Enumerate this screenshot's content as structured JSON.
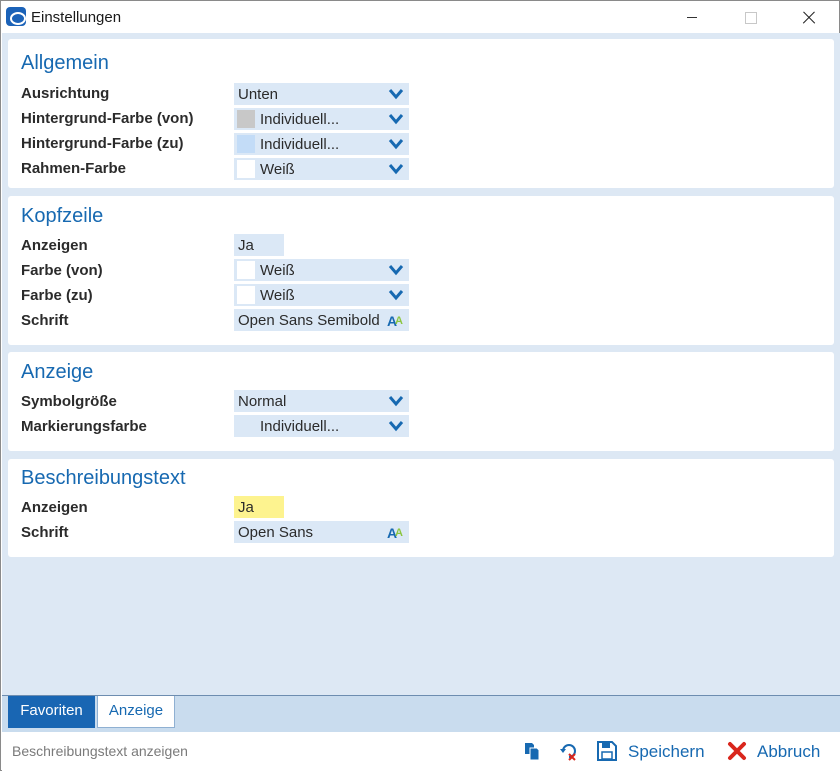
{
  "window": {
    "title": "Einstellungen"
  },
  "sections": {
    "allgemein": {
      "title": "Allgemein",
      "rows": [
        {
          "label": "Ausrichtung",
          "value": "Unten"
        },
        {
          "label": "Hintergrund-Farbe (von)",
          "value": "Individuell...",
          "swatch": "#c8c8c8"
        },
        {
          "label": "Hintergrund-Farbe (zu)",
          "value": "Individuell...",
          "swatch": "#c3dcf7"
        },
        {
          "label": "Rahmen-Farbe",
          "value": "Weiß",
          "swatch": "#ffffff"
        }
      ]
    },
    "kopfzeile": {
      "title": "Kopfzeile",
      "rows": [
        {
          "label": "Anzeigen",
          "value": "Ja"
        },
        {
          "label": "Farbe (von)",
          "value": "Weiß",
          "swatch": "#ffffff"
        },
        {
          "label": "Farbe (zu)",
          "value": "Weiß",
          "swatch": "#ffffff"
        },
        {
          "label": "Schrift",
          "value": "Open Sans Semibold"
        }
      ]
    },
    "anzeige": {
      "title": "Anzeige",
      "rows": [
        {
          "label": "Symbolgröße",
          "value": "Normal"
        },
        {
          "label": "Markierungsfarbe",
          "value": "Individuell...",
          "swatch": "#dbe8f6"
        }
      ]
    },
    "beschreibungstext": {
      "title": "Beschreibungstext",
      "rows": [
        {
          "label": "Anzeigen",
          "value": "Ja"
        },
        {
          "label": "Schrift",
          "value": "Open Sans"
        }
      ]
    }
  },
  "tabs": [
    {
      "label": "Favoriten",
      "active": false
    },
    {
      "label": "Anzeige",
      "active": true
    }
  ],
  "statusbar": {
    "text": "Beschreibungstext anzeigen",
    "save_label": "Speichern",
    "cancel_label": "Abbruch"
  },
  "colors": {
    "accent": "#1769b1",
    "field_bg": "#dbe8f6",
    "highlight_yellow": "#fdf38f",
    "panel_bg": "#dde8f4",
    "cancel_red": "#d9261c"
  }
}
